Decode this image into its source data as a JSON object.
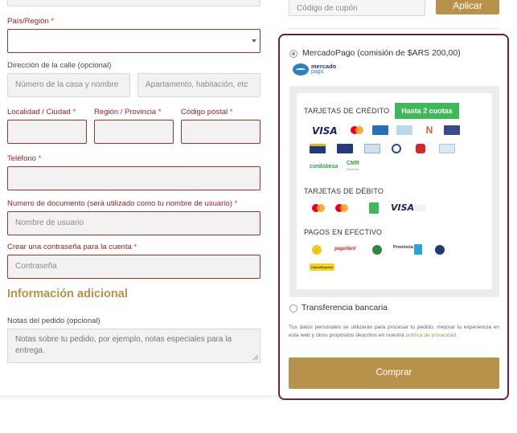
{
  "form": {
    "country": {
      "label": "País/Región",
      "required": "*",
      "value": ""
    },
    "street": {
      "label": "Dirección de la calle (opcional)",
      "placeholder1": "Número de la casa y nombre",
      "placeholder2": "Apartamento, habitación, etc"
    },
    "city": {
      "label": "Localidad / Ciudad",
      "required": "*"
    },
    "region": {
      "label": "Región / Provincia",
      "required": "*"
    },
    "postal": {
      "label": "Código postal",
      "required": "*"
    },
    "phone": {
      "label": "Teléfono",
      "required": "*"
    },
    "document": {
      "label": "Numero de documento (será utilizado como tu nombre de usuario)",
      "required": "*",
      "placeholder": "Nombre de usuario"
    },
    "password": {
      "label": "Crear una contraseña para la cuenta",
      "required": "*",
      "placeholder": "Contraseña"
    },
    "additional_title": "Información adicional",
    "notes": {
      "label": "Notas del pedido (opcional)",
      "placeholder": "Notas sobre tu pedido, por ejemplo, notas especiales para la entrega."
    }
  },
  "coupon": {
    "placeholder": "Código de cupón",
    "apply_label": "Aplicar"
  },
  "payment": {
    "mercadopago_label": "MercadoPago (comisión de $ARS 200,00)",
    "mp_logo_line1": "mercado",
    "mp_logo_line2": "pago",
    "credit_title": "TARJETAS DE CRÉDITO",
    "installments_badge": "Hasta 2 cuotas",
    "debit_title": "TARJETAS DE DÉBITO",
    "cash_title": "PAGOS EN EFECTIVO",
    "card_texts": {
      "visa": "VISA",
      "cordobesa": "cordobesa",
      "cmr": "CMR",
      "cmr_sub": "falabella",
      "pagofacil": "pagofácil",
      "provincia": "Provincia",
      "provincia_sub": "NET",
      "cobroexpress": "CobroExpress"
    },
    "bank_transfer_label": "Transferencia bancaria",
    "privacy_text": "Tus datos personales se utilizarán para procesar tu pedido, mejorar tu experiencia en esta web y otros propósitos descritos en nuestra",
    "privacy_link": "política de privacidad.",
    "buy_label": "Comprar"
  },
  "colors": {
    "accent": "#b8924a",
    "error": "#b22a2a",
    "frame": "#6a1f43",
    "badge": "#3fb85a"
  }
}
